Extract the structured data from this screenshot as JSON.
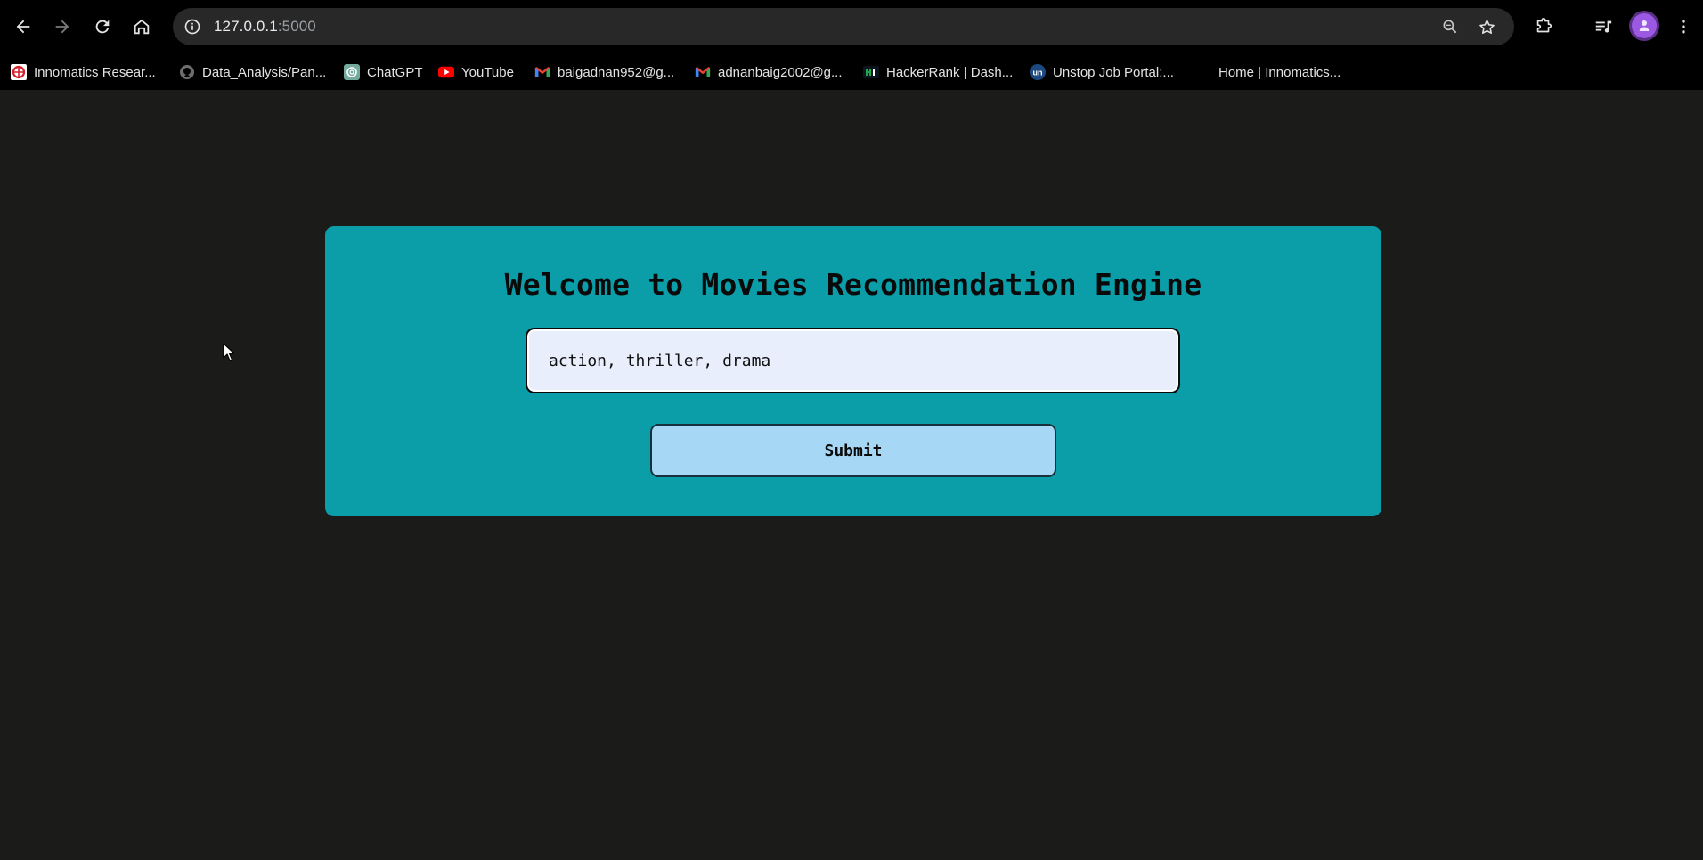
{
  "browser": {
    "url_host": "127.0.0.1",
    "url_port": ":5000",
    "icons": {
      "back": "arrow-left-icon",
      "forward": "arrow-right-icon",
      "reload": "reload-icon",
      "home": "home-icon",
      "site_info": "info-icon",
      "zoom": "magnifier-icon",
      "bookmark": "star-icon",
      "extensions": "puzzle-icon",
      "media": "playlist-icon",
      "menu": "kebab-menu-icon"
    }
  },
  "bookmarks": [
    {
      "label": "Innomatics Resear...",
      "icon": "innomatics-icon"
    },
    {
      "label": "Data_Analysis/Pan...",
      "icon": "github-icon"
    },
    {
      "label": "ChatGPT",
      "icon": "chatgpt-icon"
    },
    {
      "label": "YouTube",
      "icon": "youtube-icon"
    },
    {
      "label": "baigadnan952@g...",
      "icon": "gmail-icon"
    },
    {
      "label": "adnanbaig2002@g...",
      "icon": "gmail-icon"
    },
    {
      "label": "HackerRank | Dash...",
      "icon": "hackerrank-icon"
    },
    {
      "label": "Unstop Job Portal:...",
      "icon": "unstop-icon"
    },
    {
      "label": "Home | Innomatics...",
      "icon": "none"
    }
  ],
  "page": {
    "title": "Welcome to Movies Recommendation Engine",
    "input_value": "action, thriller, drama",
    "submit_label": "Submit",
    "colors": {
      "background": "#1b1b1a",
      "card": "#0b9da8",
      "input_bg": "#e8eefb",
      "button_bg": "#a6d8f6"
    }
  }
}
